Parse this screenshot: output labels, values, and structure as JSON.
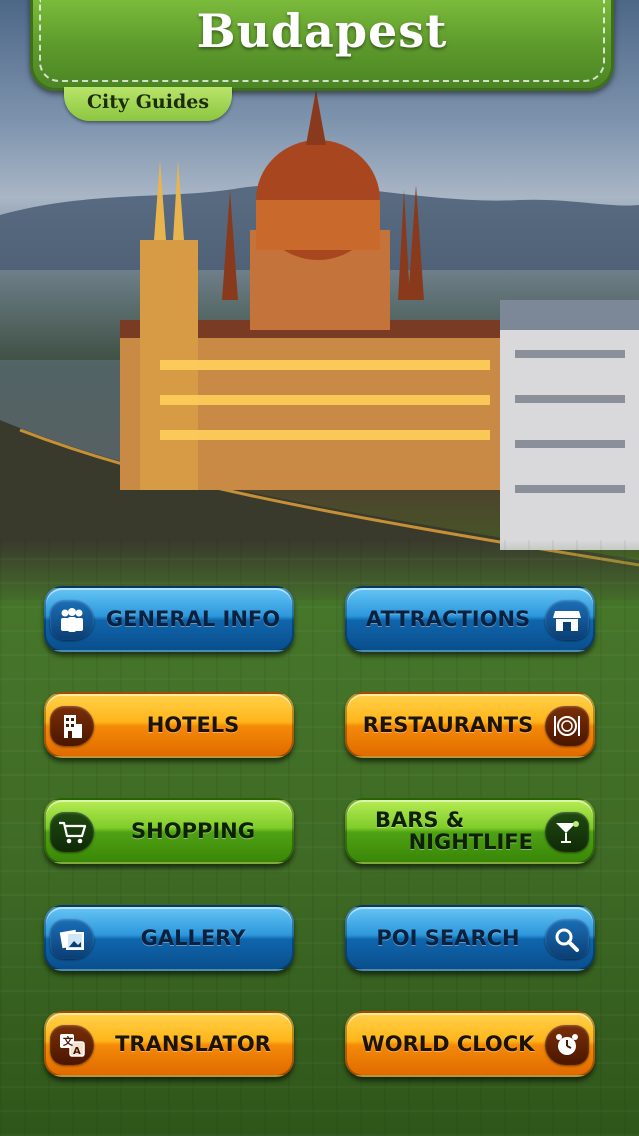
{
  "header": {
    "title": "Budapest",
    "subtitle": "City Guides"
  },
  "menu": {
    "general_info": {
      "label": "GENERAL INFO",
      "icon": "people-icon"
    },
    "attractions": {
      "label": "ATTRACTIONS",
      "icon": "storefront-icon"
    },
    "hotels": {
      "label": "HOTELS",
      "icon": "building-icon"
    },
    "restaurants": {
      "label": "RESTAURANTS",
      "icon": "plate-cutlery-icon"
    },
    "shopping": {
      "label": "SHOPPING",
      "icon": "cart-icon"
    },
    "bars_nightlife": {
      "label_line1": "BARS &",
      "label_line2": "NIGHTLIFE",
      "icon": "cocktail-icon"
    },
    "gallery": {
      "label": "GALLERY",
      "icon": "photos-icon"
    },
    "poi_search": {
      "label": "POI SEARCH",
      "icon": "magnifier-icon"
    },
    "translator": {
      "label": "TRANSLATOR",
      "icon": "translate-icon"
    },
    "world_clock": {
      "label": "WORLD CLOCK",
      "icon": "alarm-clock-icon"
    }
  },
  "colors": {
    "blue_button": "#2d98dc",
    "orange_button": "#ffb51a",
    "green_button": "#7fcc2a",
    "banner_green": "#5d9a2c",
    "background_green": "#3e6a25"
  }
}
